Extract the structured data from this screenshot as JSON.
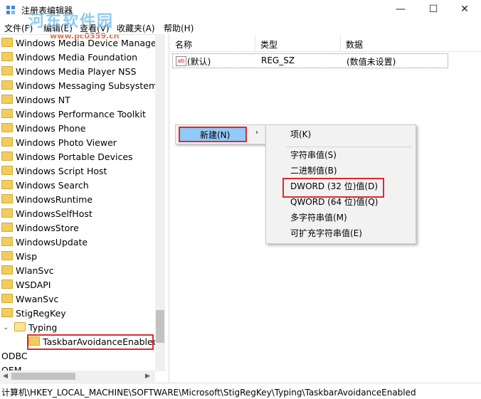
{
  "window": {
    "title": "注册表编辑器",
    "minimize": "—",
    "maximize": "☐",
    "close": "✕"
  },
  "watermark": {
    "main": "河东软件园",
    "sub": "www.pc0359.cn"
  },
  "menu": [
    "文件(F)",
    "编辑(E)",
    "查看(V)",
    "收藏夹(A)",
    "帮助(H)"
  ],
  "tree": {
    "items": [
      "Windows Media Device Manager",
      "Windows Media Foundation",
      "Windows Media Player NSS",
      "Windows Messaging Subsystem",
      "Windows NT",
      "Windows Performance Toolkit",
      "Windows Phone",
      "Windows Photo Viewer",
      "Windows Portable Devices",
      "Windows Script Host",
      "Windows Search",
      "WindowsRuntime",
      "WindowsSelfHost",
      "WindowsStore",
      "WindowsUpdate",
      "Wisp",
      "WlanSvc",
      "WSDAPI",
      "WwanSvc",
      "StigRegKey"
    ],
    "typing": "Typing",
    "selected": "TaskbarAvoidanceEnabled",
    "odbc": "ODBC",
    "oem": "OEM"
  },
  "list": {
    "headers": {
      "name": "名称",
      "type": "类型",
      "data": "数据"
    },
    "rows": [
      {
        "name": "(默认)",
        "type": "REG_SZ",
        "data": "(数值未设置)",
        "icon": "ab"
      }
    ]
  },
  "context_menu": {
    "new_label": "新建(N)",
    "submenu_arrow": "›",
    "items": [
      "项(K)",
      "字符串值(S)",
      "二进制值(B)",
      "DWORD (32 位)值(D)",
      "QWORD (64 位)值(Q)",
      "多字符串值(M)",
      "可扩充字符串值(E)"
    ]
  },
  "status": "计算机\\HKEY_LOCAL_MACHINE\\SOFTWARE\\Microsoft\\StigRegKey\\Typing\\TaskbarAvoidanceEnabled",
  "colors": {
    "highlight": "#91c9f7",
    "callout": "#e0282e",
    "folder": "#f2cd5d"
  }
}
